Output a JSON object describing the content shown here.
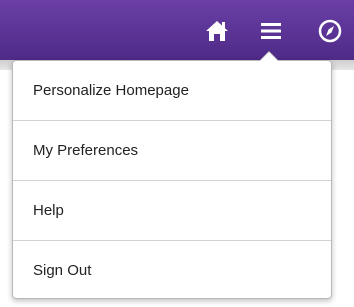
{
  "header": {
    "icons": [
      "home-icon",
      "hamburger-menu-icon",
      "navigator-compass-icon"
    ],
    "bar_color": "#5b3296"
  },
  "menu": {
    "items": [
      {
        "label": "Personalize Homepage"
      },
      {
        "label": "My Preferences"
      },
      {
        "label": "Help"
      },
      {
        "label": "Sign Out"
      }
    ]
  }
}
